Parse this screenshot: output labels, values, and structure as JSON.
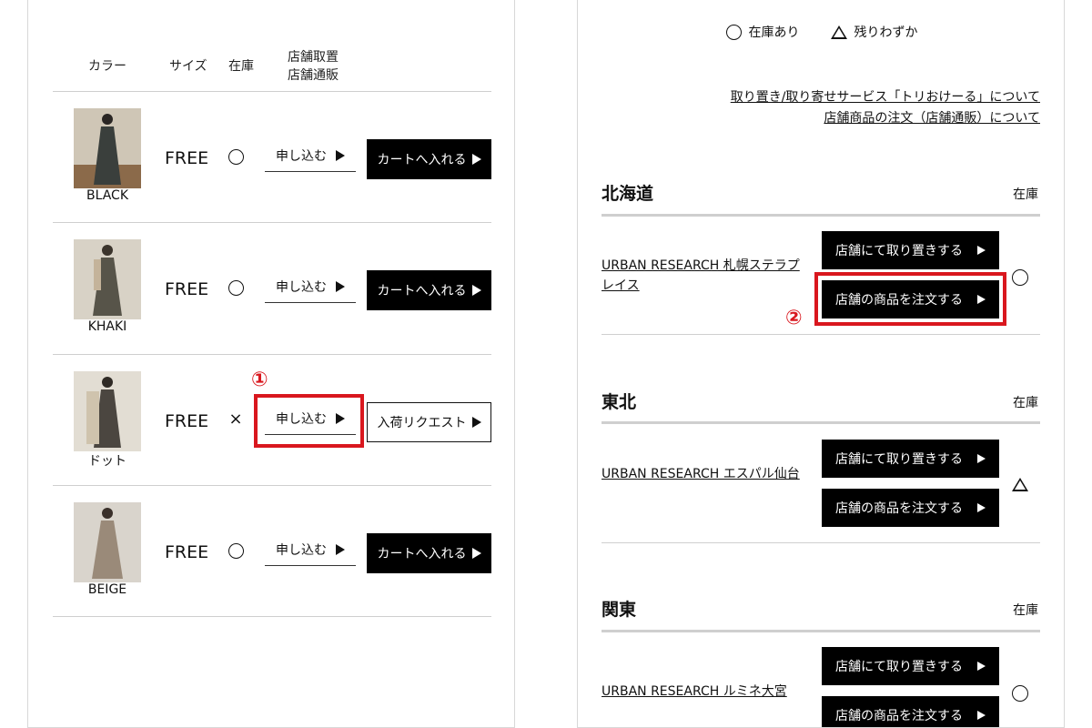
{
  "left": {
    "headers": {
      "color": "カラー",
      "size": "サイズ",
      "stock": "在庫",
      "store_line1": "店舗取置",
      "store_line2": "店舗通販"
    },
    "rows": [
      {
        "color": "BLACK",
        "size": "FREE",
        "stock": "circle",
        "apply": "申し込む",
        "action": "カートへ入れる",
        "action_type": "cart",
        "swatch": "#3a3f3c"
      },
      {
        "color": "KHAKI",
        "size": "FREE",
        "stock": "circle",
        "apply": "申し込む",
        "action": "カートへ入れる",
        "action_type": "cart",
        "swatch": "#575449"
      },
      {
        "color": "ドット",
        "size": "FREE",
        "stock": "×",
        "apply": "申し込む",
        "action": "入荷リクエスト",
        "action_type": "request",
        "swatch": "#4b4640"
      },
      {
        "color": "BEIGE",
        "size": "FREE",
        "stock": "circle",
        "apply": "申し込む",
        "action": "カートへ入れる",
        "action_type": "cart",
        "swatch": "#9a8a79"
      }
    ],
    "annotation_number": "①"
  },
  "right": {
    "legend": {
      "in_stock": "在庫あり",
      "low_stock": "残りわずか"
    },
    "links": {
      "service": "取り置き/取り寄せサービス「トリおけーる」について",
      "order": "店舗商品の注文（店舗通販）について"
    },
    "regions": [
      {
        "title": "北海道",
        "stock_label": "在庫",
        "store": "URBAN RESEARCH 札幌ステラプレイス",
        "stock_mark": "circle",
        "hold_button": "店舗にて取り置きする",
        "order_button": "店舗の商品を注文する"
      },
      {
        "title": "東北",
        "stock_label": "在庫",
        "store": "URBAN RESEARCH エスパル仙台",
        "stock_mark": "triangle",
        "hold_button": "店舗にて取り置きする",
        "order_button": "店舗の商品を注文する"
      },
      {
        "title": "関東",
        "stock_label": "在庫",
        "store": "URBAN RESEARCH ルミネ大宮",
        "stock_mark": "circle",
        "hold_button": "店舗にて取り置きする",
        "order_button": "店舗の商品を注文する"
      }
    ],
    "annotation_number": "②"
  },
  "colors": {
    "annotation": "#d9171e",
    "button_bg": "#000000",
    "rule": "#cfcfcf"
  }
}
